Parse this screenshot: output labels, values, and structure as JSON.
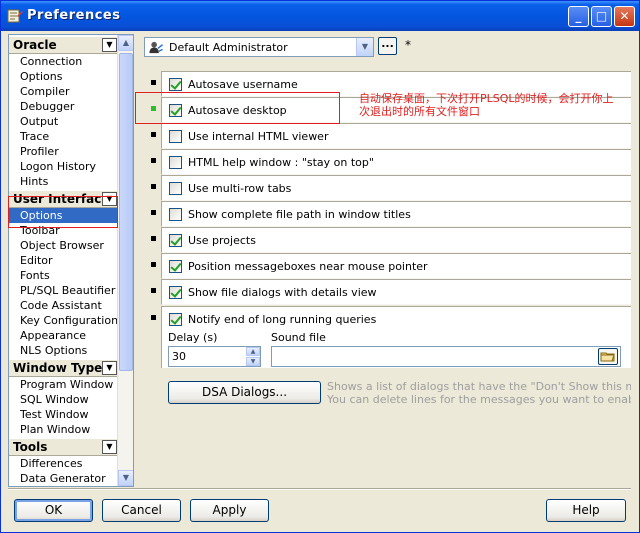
{
  "window": {
    "title": "Preferences"
  },
  "navigator": {
    "sections": [
      {
        "label": "Oracle",
        "items": [
          "Connection",
          "Options",
          "Compiler",
          "Debugger",
          "Output",
          "Trace",
          "Profiler",
          "Logon History",
          "Hints"
        ]
      },
      {
        "label": "User Interface",
        "items": [
          "Options",
          "Toolbar",
          "Object Browser",
          "Editor",
          "Fonts",
          "PL/SQL Beautifier",
          "Code Assistant",
          "Key Configuration",
          "Appearance",
          "NLS Options"
        ]
      },
      {
        "label": "Window Types",
        "items": [
          "Program Window",
          "SQL Window",
          "Test Window",
          "Plan Window"
        ]
      },
      {
        "label": "Tools",
        "items": [
          "Differences",
          "Data Generator"
        ]
      }
    ],
    "selected": "User Interface / Options"
  },
  "user_set": {
    "value": "Default Administrator",
    "dots_label": "...",
    "modified_marker": "*"
  },
  "options": [
    {
      "label": "Autosave username",
      "checked": true
    },
    {
      "label": "Autosave desktop",
      "checked": true
    },
    {
      "label": "Use internal HTML viewer",
      "checked": false
    },
    {
      "label": "HTML help window : \"stay on top\"",
      "checked": false
    },
    {
      "label": "Use multi-row tabs",
      "checked": false
    },
    {
      "label": "Show complete file path in window titles",
      "checked": false
    },
    {
      "label": "Use projects",
      "checked": true
    },
    {
      "label": "Position messageboxes near mouse pointer",
      "checked": true
    },
    {
      "label": "Show file dialogs with details view",
      "checked": true
    },
    {
      "label": "Notify end of long running queries",
      "checked": true
    }
  ],
  "notify": {
    "delay_label": "Delay (s)",
    "delay_value": "30",
    "sound_label": "Sound file",
    "sound_value": ""
  },
  "dsa": {
    "button_label": "DSA Dialogs...",
    "description_line1": "Shows a list of dialogs that have the \"Don't Show this message A",
    "description_line2": "You can delete lines for the messages you want to enable"
  },
  "annotation": {
    "line1": "自动保存桌面，下次打开PLSQL的时候，会打开你上",
    "line2": "次退出时的所有文件窗口"
  },
  "buttons": {
    "ok": "OK",
    "cancel": "Cancel",
    "apply": "Apply",
    "help": "Help"
  }
}
